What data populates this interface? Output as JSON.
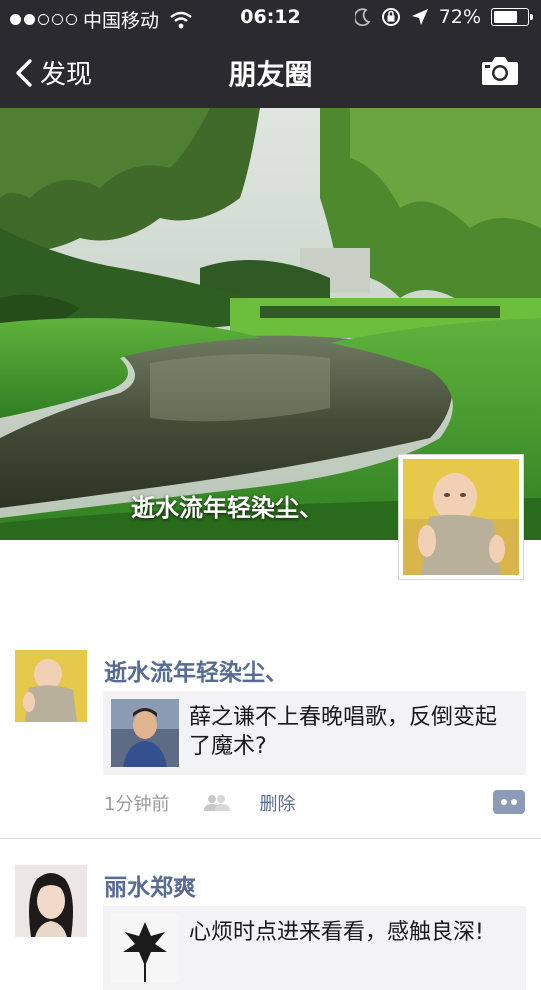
{
  "status_bar": {
    "carrier": "中国移动",
    "time": "06:12",
    "battery": "72%",
    "battery_level": 0.72
  },
  "nav": {
    "back_label": "发现",
    "title": "朋友圈"
  },
  "cover": {
    "name": "逝水流年轻染尘、"
  },
  "posts": [
    {
      "name": "逝水流年轻染尘、",
      "link_text": "薛之谦不上春晚唱歌，反倒变起了魔术?",
      "time": "1分钟前",
      "delete_label": "删除"
    },
    {
      "name": "丽水郑爽",
      "link_text": "心烦时点进来看看，感触良深!"
    }
  ],
  "colors": {
    "nav_bg": "#2b2b2f",
    "name_blue": "#576b95",
    "link_bg": "#f3f3f5"
  }
}
